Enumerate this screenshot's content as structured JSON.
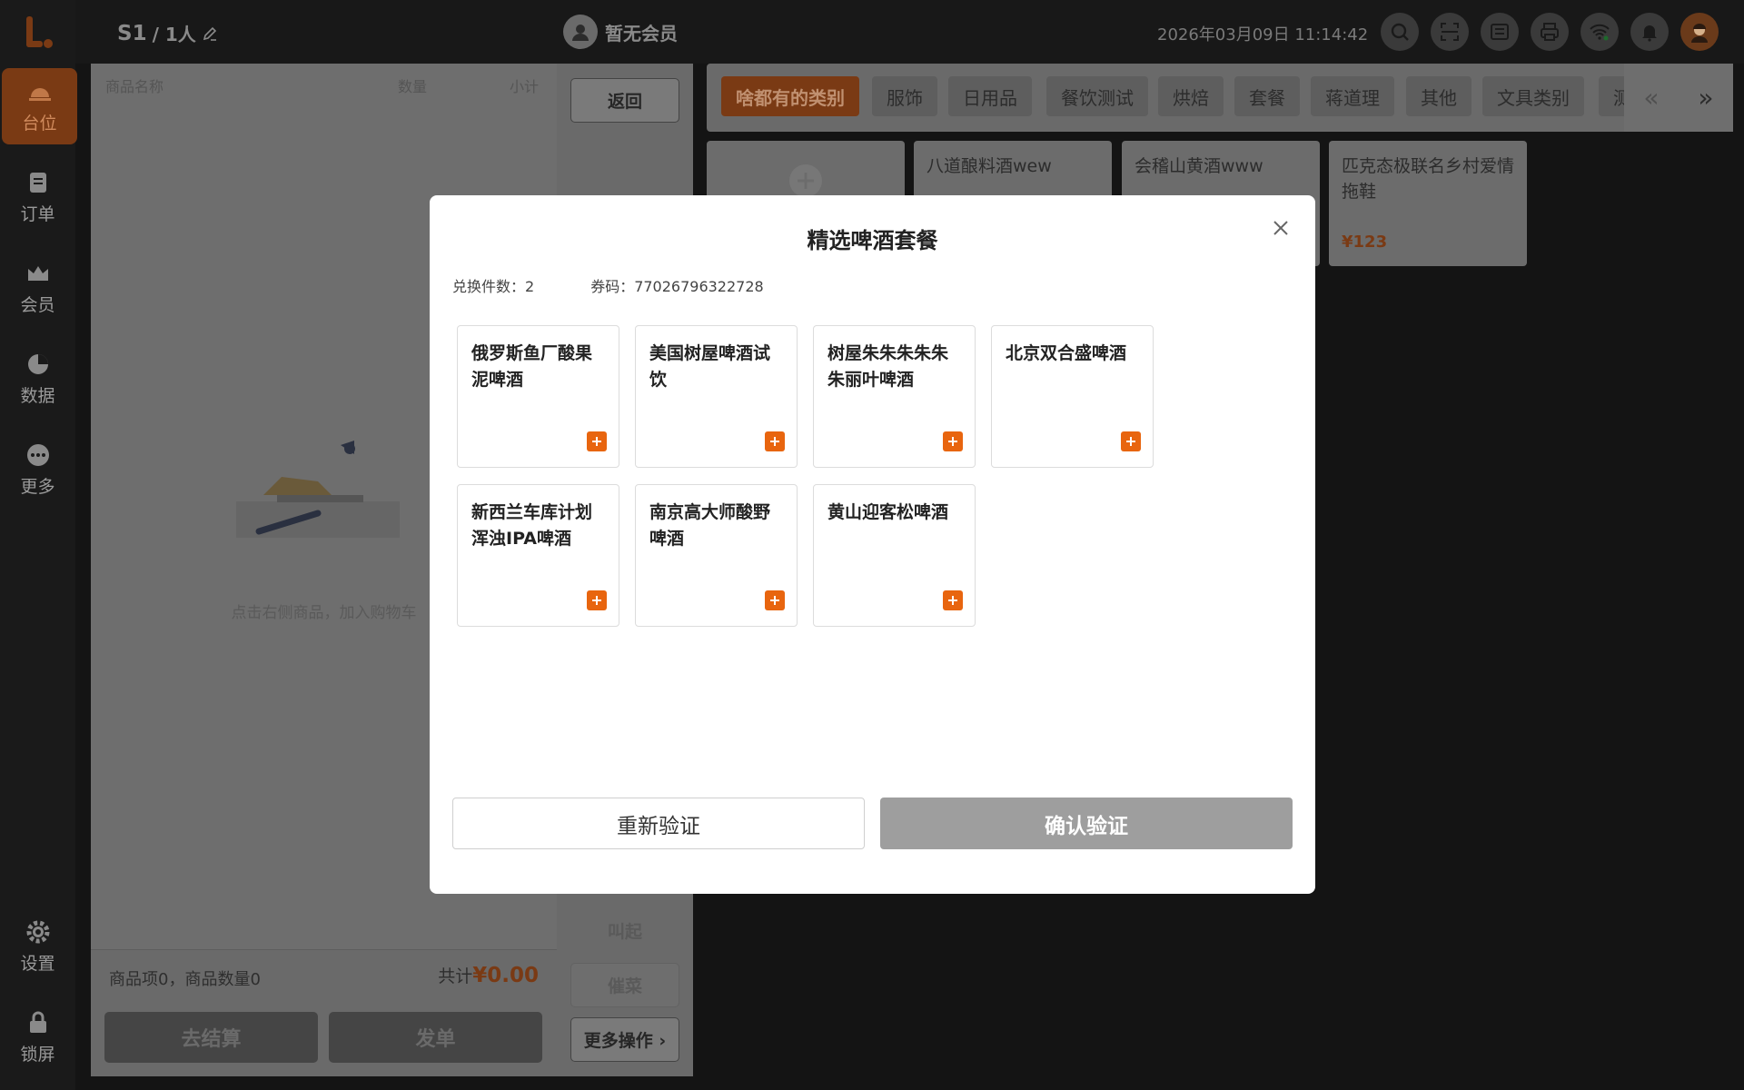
{
  "sidebar": {
    "items": [
      {
        "label": "台位"
      },
      {
        "label": "订单"
      },
      {
        "label": "会员"
      },
      {
        "label": "数据"
      },
      {
        "label": "更多"
      },
      {
        "label": "设置"
      },
      {
        "label": "锁屏"
      }
    ]
  },
  "header": {
    "table": "S1",
    "guests": "/ 1人",
    "member": "暂无会员",
    "datetime": "2026年03月09日 11:14:42"
  },
  "cart": {
    "col_name": "商品名称",
    "col_qty": "数量",
    "col_subtotal": "小计",
    "empty_hint": "点击右侧商品，加入购物车",
    "summary": "商品项0，商品数量0",
    "total_label": "共计",
    "total_value": "¥0.00",
    "checkout": "去结算",
    "send": "发单"
  },
  "ops": {
    "back": "返回",
    "call": "叫起",
    "rush": "催菜",
    "more": "更多操作 ›"
  },
  "categories": [
    "啥都有的类别",
    "服饰",
    "日用品",
    "餐饮测试",
    "烘焙",
    "套餐",
    "蒋道理",
    "其他",
    "文具类别",
    "测"
  ],
  "products": [
    {
      "name": "八道酿料酒wew",
      "price": ""
    },
    {
      "name": "会稽山黄酒www",
      "price": ""
    },
    {
      "name": "匹克态极联名乡村爱情拖鞋",
      "price": "¥123"
    }
  ],
  "modal": {
    "title": "精选啤酒套餐",
    "exchange_label": "兑换件数：2",
    "code_label": "券码：77026796322728",
    "items": [
      {
        "name": "俄罗斯鱼厂酸果泥啤酒"
      },
      {
        "name": "美国树屋啤酒试饮"
      },
      {
        "name": "树屋朱朱朱朱朱朱丽叶啤酒"
      },
      {
        "name": "北京双合盛啤酒"
      },
      {
        "name": "新西兰车库计划浑浊IPA啤酒"
      },
      {
        "name": "南京高大师酸野啤酒"
      },
      {
        "name": "黄山迎客松啤酒"
      }
    ],
    "reverify": "重新验证",
    "confirm": "确认验证"
  },
  "colors": {
    "accent": "#e8650f",
    "confirm_disabled": "#9e9e9e"
  }
}
